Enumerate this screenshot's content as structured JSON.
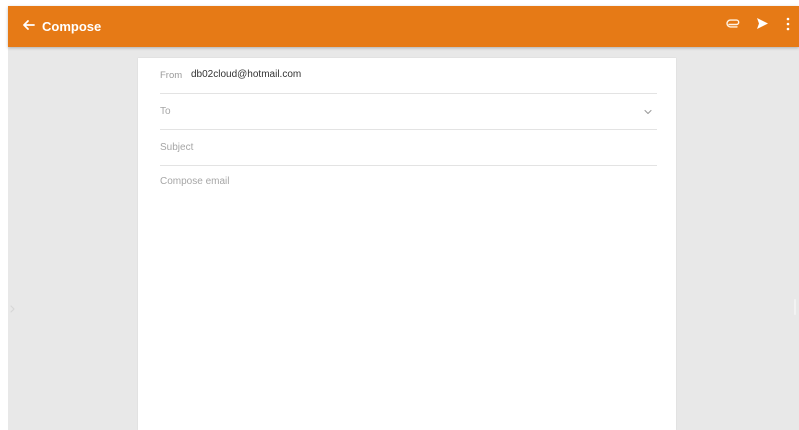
{
  "colors": {
    "accent": "#E67A16",
    "background": "#E8E8E8",
    "card": "#FFFFFF"
  },
  "header": {
    "title": "Compose",
    "icons": {
      "back": "arrow-left-icon",
      "attach": "paperclip-icon",
      "send": "send-icon",
      "more": "more-vertical-icon"
    }
  },
  "compose": {
    "from_label": "From",
    "from_value": "db02cloud@hotmail.com",
    "to_placeholder": "To",
    "subject_placeholder": "Subject",
    "body_placeholder": "Compose email"
  }
}
